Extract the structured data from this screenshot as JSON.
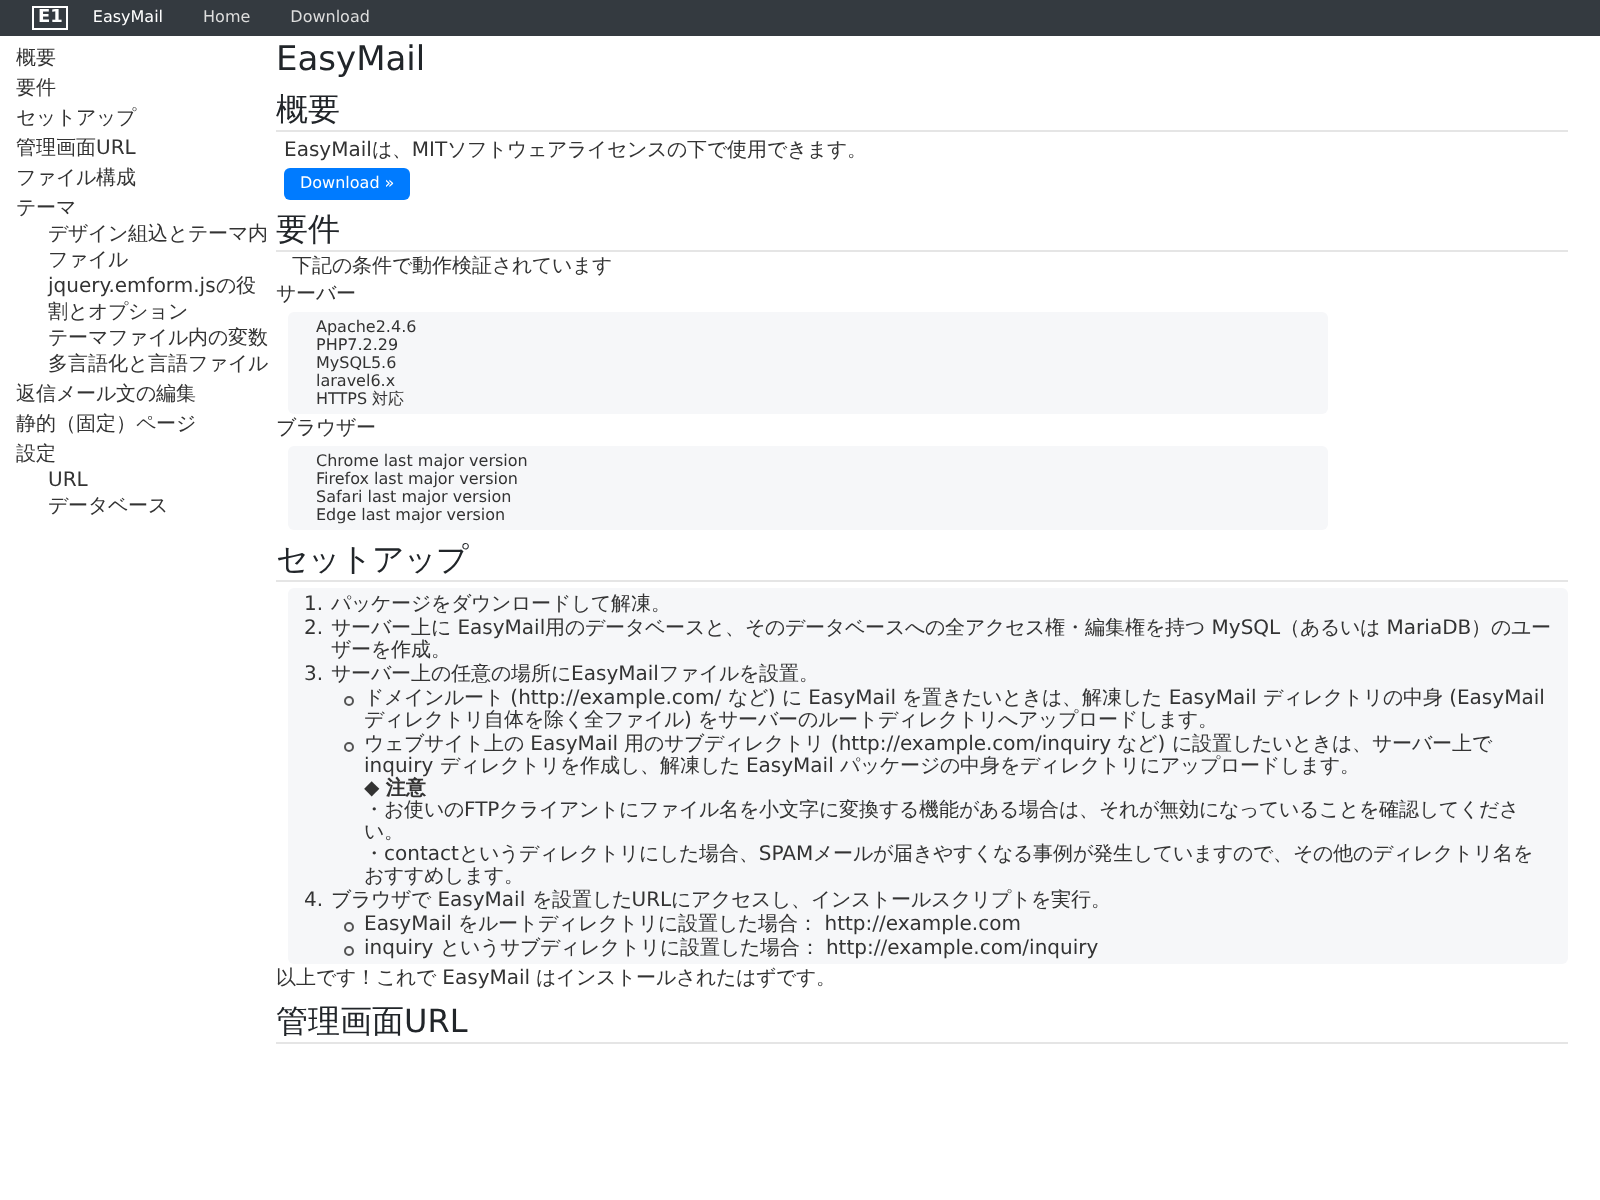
{
  "navbar": {
    "logo": "E1",
    "brand": "EasyMail",
    "links": [
      "Home",
      "Download"
    ]
  },
  "sidebar": {
    "items": [
      {
        "label": "概要"
      },
      {
        "label": "要件"
      },
      {
        "label": "セットアップ"
      },
      {
        "label": "管理画面URL"
      },
      {
        "label": "ファイル構成"
      },
      {
        "label": "テーマ",
        "children": [
          {
            "label": "デザイン組込とテーマ内ファイル"
          },
          {
            "label": "jquery.emform.jsの役割とオプション"
          },
          {
            "label": "テーマファイル内の変数"
          },
          {
            "label": "多言語化と言語ファイル"
          }
        ]
      },
      {
        "label": "返信メール文の編集"
      },
      {
        "label": "静的（固定）ページ"
      },
      {
        "label": "設定",
        "children": [
          {
            "label": "URL"
          },
          {
            "label": "データベース"
          }
        ]
      }
    ]
  },
  "main": {
    "title": "EasyMail",
    "overview": {
      "heading": "概要",
      "text": "EasyMailは、MITソフトウェアライセンスの下で使用できます。",
      "button": "Download »"
    },
    "requirements": {
      "heading": "要件",
      "intro": "下記の条件で動作検証されています",
      "groups": [
        {
          "label": "サーバー",
          "items": [
            "Apache2.4.6",
            "PHP7.2.29",
            "MySQL5.6",
            "laravel6.x",
            "HTTPS 対応"
          ]
        },
        {
          "label": "ブラウザー",
          "items": [
            "Chrome last major version",
            "Firefox last major version",
            "Safari last major version",
            "Edge last major version"
          ]
        }
      ]
    },
    "setup": {
      "heading": "セットアップ",
      "steps": [
        {
          "number": "1.",
          "text": "パッケージをダウンロードして解凍。"
        },
        {
          "number": "2.",
          "text": "サーバー上に EasyMail用のデータベースと、そのデータベースへの全アクセス権・編集権を持つ MySQL（あるいは MariaDB）のユーザーを作成。"
        },
        {
          "number": "3.",
          "text": "サーバー上の任意の場所にEasyMailファイルを設置。",
          "children": [
            {
              "text": "ドメインルート (http://example.com/ など) に EasyMail を置きたいときは、解凍した EasyMail ディレクトリの中身 (EasyMail ディレクトリ自体を除く全ファイル) をサーバーのルートディレクトリへアップロードします。"
            },
            {
              "text": "ウェブサイト上の EasyMail 用のサブディレクトリ (http://example.com/inquiry など) に設置したいときは、サーバー上で inquiry ディレクトリを作成し、解凍した EasyMail パッケージの中身をディレクトリにアップロードします。",
              "note": {
                "title": "◆ 注意",
                "lines": [
                  "・お使いのFTPクライアントにファイル名を小文字に変換する機能がある場合は、それが無効になっていることを確認してください。",
                  "・contactというディレクトリにした場合、SPAMメールが届きやすくなる事例が発生していますので、その他のディレクトリ名をおすすめします。"
                ]
              }
            }
          ]
        },
        {
          "number": "4.",
          "text": "ブラウザで EasyMail を設置したURLにアクセスし、インストールスクリプトを実行。",
          "children": [
            {
              "text": "EasyMail をルートディレクトリに設置した場合： http://example.com"
            },
            {
              "text": "inquiry というサブディレクトリに設置した場合： http://example.com/inquiry"
            }
          ]
        }
      ],
      "footer": "以上です！これで EasyMail はインストールされたはずです。"
    },
    "next_heading": "管理画面URL"
  }
}
